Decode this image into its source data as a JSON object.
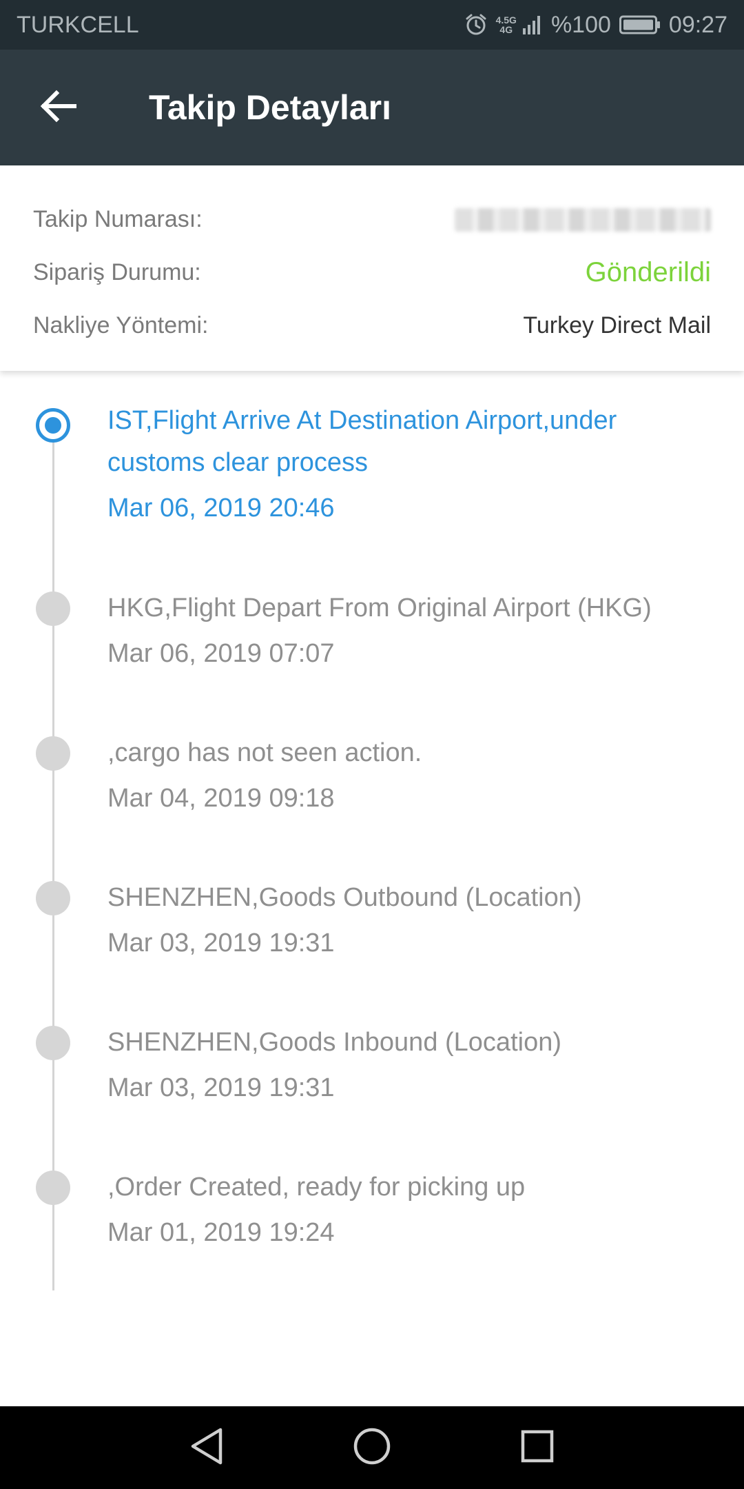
{
  "status_bar": {
    "carrier": "TURKCELL",
    "network_top": "4.5G",
    "network_bottom": "4G",
    "battery_text": "%100",
    "time": "09:27",
    "icons": [
      "alarm-icon",
      "signal-icon",
      "battery-icon"
    ]
  },
  "app_bar": {
    "title": "Takip Detayları",
    "back_icon": "arrow-left-icon"
  },
  "info": {
    "tracking_label": "Takip Numarası:",
    "tracking_value": "",
    "status_label": "Sipariş Durumu:",
    "status_value": "Gönderildi",
    "shipping_label": "Nakliye Yöntemi:",
    "shipping_value": "Turkey Direct Mail"
  },
  "events": [
    {
      "text": "IST,Flight Arrive At Destination Airport,under customs clear process",
      "time": "Mar 06, 2019 20:46",
      "active": true
    },
    {
      "text": "HKG,Flight Depart From Original Airport (HKG)",
      "time": "Mar 06, 2019 07:07",
      "active": false
    },
    {
      "text": ",cargo has not seen action.",
      "time": "Mar 04, 2019 09:18",
      "active": false
    },
    {
      "text": "SHENZHEN,Goods Outbound (Location)",
      "time": "Mar 03, 2019 19:31",
      "active": false
    },
    {
      "text": "SHENZHEN,Goods Inbound (Location)",
      "time": "Mar 03, 2019 19:31",
      "active": false
    },
    {
      "text": ",Order Created, ready for picking up",
      "time": "Mar 01, 2019 19:24",
      "active": false
    }
  ],
  "colors": {
    "status_bar_bg": "#222d33",
    "app_bar_bg": "#2f3b42",
    "accent_blue": "#2d93dd",
    "status_green": "#7cd33b",
    "inactive_text": "#8f8f8f"
  },
  "nav_bar": {
    "icons": [
      "back-triangle-icon",
      "home-circle-icon",
      "recents-square-icon"
    ]
  }
}
